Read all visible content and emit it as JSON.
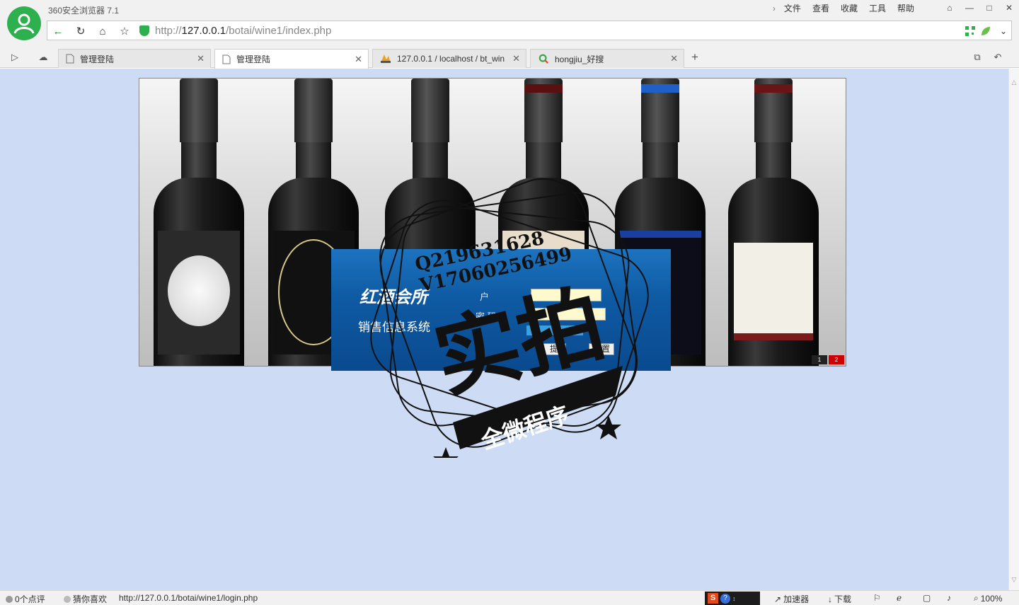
{
  "browser": {
    "title": "360安全浏览器 7.1",
    "menu": [
      "文件",
      "查看",
      "收藏",
      "工具",
      "帮助"
    ],
    "url_prefix": "http://",
    "url_host": "127.0.0.1",
    "url_path": "/botai/wine1/index.php"
  },
  "tabs": [
    {
      "label": "管理登陆",
      "icon": "page-icon",
      "active": false
    },
    {
      "label": "管理登陆",
      "icon": "page-icon",
      "active": true
    },
    {
      "label": "127.0.0.1 / localhost / bt_win",
      "icon": "phpmyadmin-icon",
      "active": false
    },
    {
      "label": "hongjiu_好搜",
      "icon": "haosou-icon",
      "active": false
    }
  ],
  "page": {
    "brand_title": "红酒会所",
    "brand_subtitle": "销售信息系统",
    "username_label": "户",
    "password_label": "密  码",
    "submit_label": "提",
    "reset_label": "重置",
    "slides": [
      "1",
      "2"
    ],
    "active_slide": "2"
  },
  "watermark": {
    "qq": "Q219631628",
    "wechat": "V17060256499",
    "main": "实拍",
    "ribbon": "全微程序"
  },
  "statusbar": {
    "reviews": "0个点评",
    "guess": "猜你喜欢",
    "link_url": "http://127.0.0.1/botai/wine1/login.php",
    "accelerator": "加速器",
    "download": "下载",
    "zoom": "100%"
  },
  "colors": {
    "content_bg": "#cddcf4",
    "accent_green": "#2fb04f",
    "panel_blue": "#0e5aa3"
  }
}
